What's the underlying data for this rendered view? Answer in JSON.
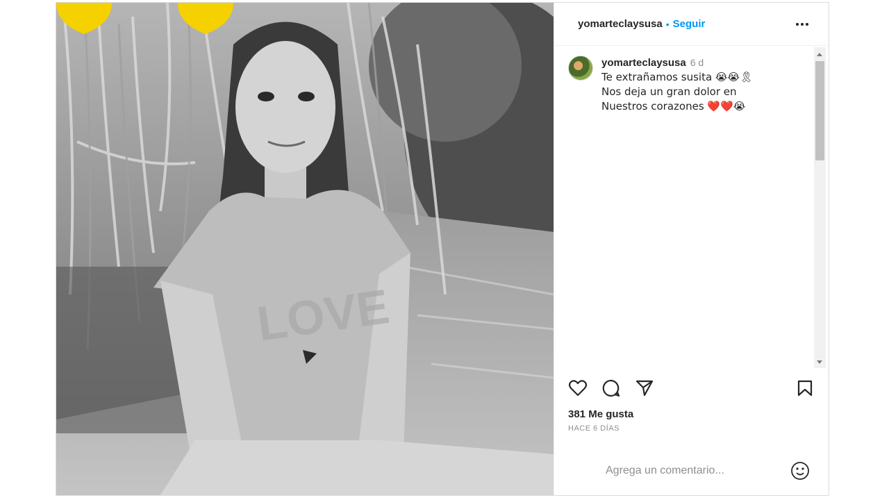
{
  "post": {
    "image_alt": "Black and white photo of a girl sitting by a stream",
    "shirt_text": "LOVE"
  },
  "header": {
    "username": "yomarteclaysusa",
    "separator": "•",
    "follow_label": "Seguir",
    "more_icon": "more-horizontal-icon"
  },
  "caption": {
    "username": "yomarteclaysusa",
    "time": "6 d",
    "lines": [
      "Te extrañamos susita 😭😭🎗",
      "Nos deja un gran dolor en",
      "Nuestros corazones ❤️❤️😭"
    ]
  },
  "actions": {
    "like_icon": "heart-icon",
    "comment_icon": "comment-icon",
    "share_icon": "share-icon",
    "save_icon": "bookmark-icon"
  },
  "likes_text": "381 Me gusta",
  "time_ago": "HACE 6 DÍAS",
  "comment": {
    "placeholder": "Agrega un comentario...",
    "emoji_icon": "smiley-icon"
  },
  "colors": {
    "accent": "#0095f6",
    "yellow_heart": "#f5d100",
    "text": "#262626",
    "muted": "#8e8e8e"
  }
}
